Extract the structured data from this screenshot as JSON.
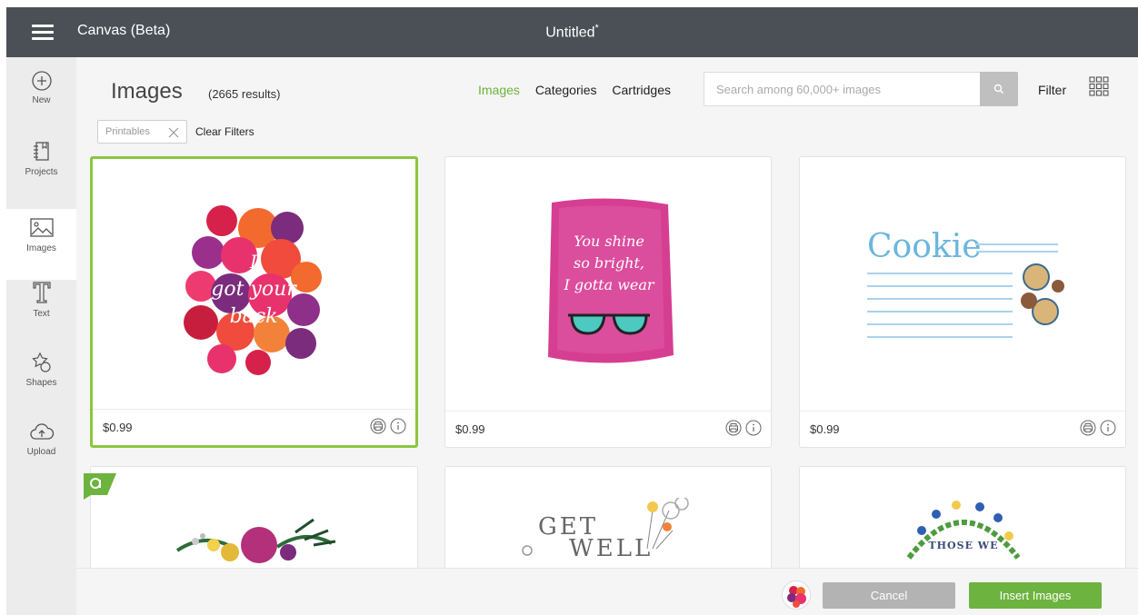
{
  "header": {
    "app_title": "Canvas (Beta)",
    "doc_title": "Untitled",
    "unsaved_mark": "*"
  },
  "sidebar": {
    "items": [
      {
        "label": "New",
        "icon": "plus-circle-icon"
      },
      {
        "label": "Projects",
        "icon": "projects-icon"
      },
      {
        "label": "Images",
        "icon": "image-icon",
        "active": true
      },
      {
        "label": "Text",
        "icon": "text-t-icon"
      },
      {
        "label": "Shapes",
        "icon": "shapes-icon"
      },
      {
        "label": "Upload",
        "icon": "upload-cloud-icon"
      }
    ]
  },
  "main": {
    "title": "Images",
    "results": "(2665 results)",
    "tabs": [
      {
        "label": "Images",
        "active": true
      },
      {
        "label": "Categories"
      },
      {
        "label": "Cartridges"
      }
    ],
    "search": {
      "placeholder": "Search among 60,000+ images",
      "value": ""
    },
    "filter_label": "Filter",
    "chip": {
      "label": "Printables"
    },
    "clear_filters": "Clear Filters"
  },
  "cards": [
    {
      "price": "$0.99",
      "art_text": "I got your back"
    },
    {
      "price": "$0.99",
      "art_text": "You shine so bright, I gotta wear"
    },
    {
      "price": "$0.99",
      "art_text": "Cookie"
    },
    {
      "price": "",
      "art_text": ""
    },
    {
      "price": "",
      "art_text": "GET WELL"
    },
    {
      "price": "",
      "art_text": "THOSE WE"
    }
  ],
  "footer": {
    "cancel_label": "Cancel",
    "insert_label": "Insert Images"
  },
  "colors": {
    "accent": "#6db33f",
    "selected_border": "#8cc63f",
    "topbar": "#4a5056",
    "cancel": "#b3b3b3"
  }
}
